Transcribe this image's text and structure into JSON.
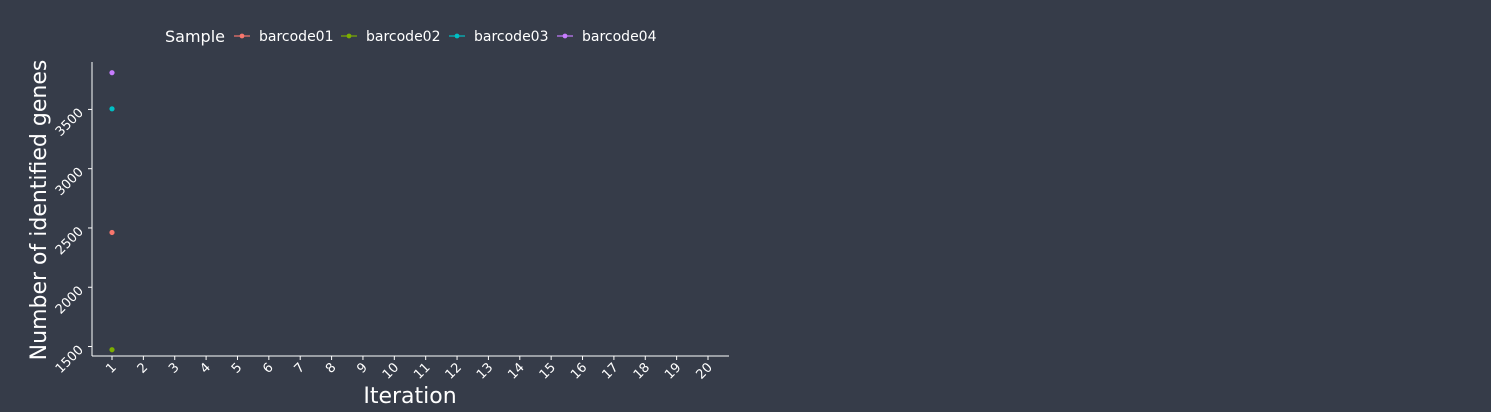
{
  "chart_data": {
    "type": "scatter",
    "xlabel": "Iteration",
    "ylabel": "Number of identified genes",
    "x_ticks": [
      "1",
      "2",
      "3",
      "4",
      "5",
      "6",
      "7",
      "8",
      "9",
      "10",
      "11",
      "12",
      "13",
      "14",
      "15",
      "16",
      "17",
      "18",
      "19",
      "20"
    ],
    "y_ticks": [
      1500,
      2000,
      2500,
      3000,
      3500
    ],
    "xlim": [
      1,
      20
    ],
    "ylim": [
      1420,
      3900
    ],
    "grid": false,
    "legend": {
      "title": "Sample",
      "position": "top"
    },
    "series": [
      {
        "name": "barcode01",
        "color": "#f8766d",
        "x": [
          1
        ],
        "y": [
          2462
        ]
      },
      {
        "name": "barcode02",
        "color": "#7cae00",
        "x": [
          1
        ],
        "y": [
          1473
        ]
      },
      {
        "name": "barcode03",
        "color": "#00bfc4",
        "x": [
          1
        ],
        "y": [
          3505
        ]
      },
      {
        "name": "barcode04",
        "color": "#c77cff",
        "x": [
          1
        ],
        "y": [
          3810
        ]
      }
    ],
    "colors": {
      "background": "#363c49",
      "axis": "#ffffff",
      "text": "#ffffff"
    }
  }
}
